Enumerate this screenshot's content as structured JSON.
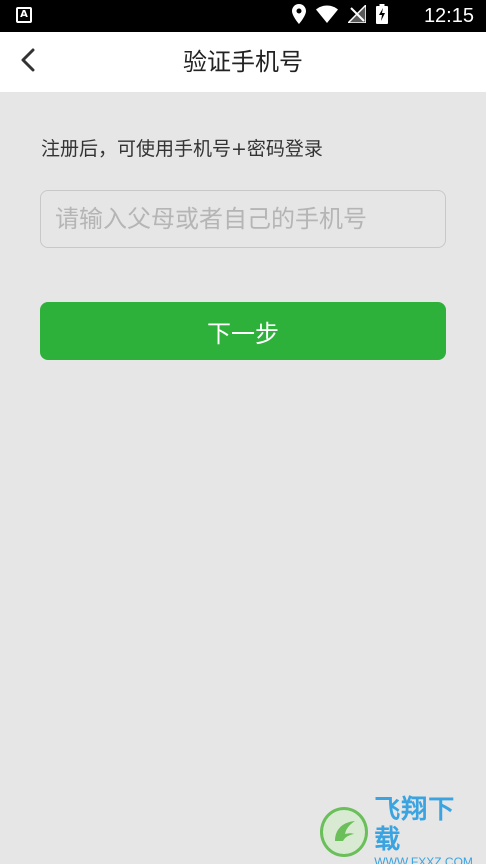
{
  "status_bar": {
    "notification_icon_label": "A",
    "time": "12:15",
    "icons": [
      "location-icon",
      "wifi-icon",
      "no-signal-icon",
      "battery-charging-icon"
    ]
  },
  "app_bar": {
    "title": "验证手机号",
    "back_icon": "chevron-left-icon"
  },
  "main": {
    "hint": "注册后，可使用手机号+密码登录",
    "phone_input": {
      "value": "",
      "placeholder": "请输入父母或者自己的手机号"
    },
    "next_button_label": "下一步"
  },
  "watermark": {
    "title": "飞翔下载",
    "url": "WWW.FXXZ.COM"
  },
  "colors": {
    "accent": "#2db13b",
    "background": "#e6e6e6",
    "app_bar": "#ffffff",
    "status_bar": "#000000"
  }
}
